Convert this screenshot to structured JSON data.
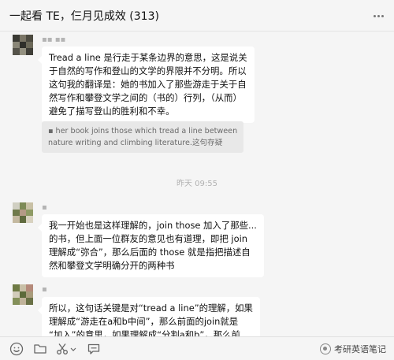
{
  "window": {
    "title": "一起看 TE，仨月见成效 (313)"
  },
  "messages": [
    {
      "sender": "▪▪ ▪▪",
      "lines": [
        "Tread a line 是行走于某条边界的意思，这是说关",
        "于自然的写作和登山的文学的界限并不分明。所以",
        "这句我的翻译是：她的书加入了那些游走于关于自",
        "然写作和攀登文学之间的（书的）行列，（从而）",
        "避免了描写登山的胜利和不幸。"
      ],
      "quote_lines": [
        "▪ her book joins those which tread a line between",
        "nature writing and climbing literature.这句存疑"
      ]
    },
    {
      "sender": "▪",
      "lines": [
        "我一开始也是这样理解的，join those 加入了那些...",
        "的书，但上面一位群友的意见也有道理，即把 join",
        "理解成“弥合”，那么后面的 those 就是指把描述自",
        "然和攀登文学明确分开的两种书"
      ]
    },
    {
      "sender": "▪",
      "lines": [
        "所以，这句话关键是对“tread a line”的理解，如果",
        "理解成“游走在a和b中间”，那么前面的join就是",
        "“加入”的意思，如果理解成“分割a和b”，那么前"
      ]
    }
  ],
  "timestamp": "昨天 09:55",
  "toolbar": {
    "icons": [
      "emoji-icon",
      "folder-icon",
      "scissors-icon",
      "chat-history-icon"
    ],
    "watermark": "考研英语笔记"
  },
  "colors": {
    "background": "#f5f5f5",
    "bubble": "#ffffff",
    "quote": "#e8e8e8",
    "muted_text": "#b2b2b2"
  }
}
